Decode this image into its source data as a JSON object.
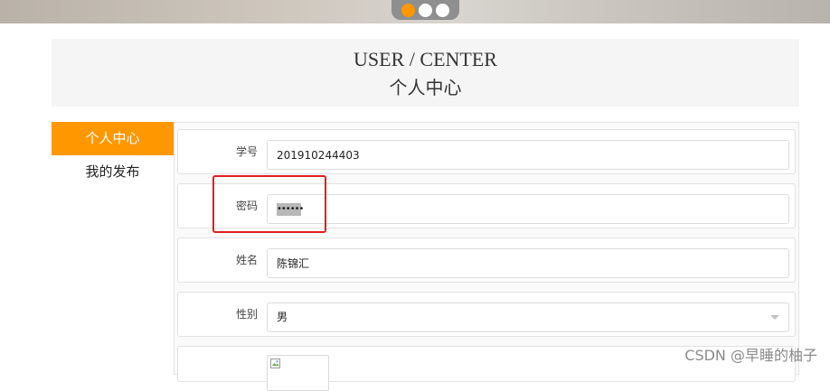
{
  "carousel": {
    "dots": 3,
    "active_index": 0,
    "active_color": "#ff9800"
  },
  "header": {
    "title_en": "USER / CENTER",
    "title_zh": "个人中心"
  },
  "sidebar": {
    "items": [
      {
        "label": "个人中心",
        "active": true
      },
      {
        "label": "我的发布",
        "active": false
      }
    ]
  },
  "form": {
    "student_id": {
      "label": "学号",
      "value": "201910244403"
    },
    "password": {
      "label": "密码",
      "value": "••••••"
    },
    "name": {
      "label": "姓名",
      "value": "陈锦汇"
    },
    "gender": {
      "label": "性别",
      "selected": "男"
    }
  },
  "icons": {
    "dropdown": "chevron-down-icon",
    "avatar_placeholder": "broken-image-icon"
  },
  "colors": {
    "accent": "#ff9800",
    "highlight": "#e02020"
  },
  "watermark": "CSDN @早睡的柚子"
}
